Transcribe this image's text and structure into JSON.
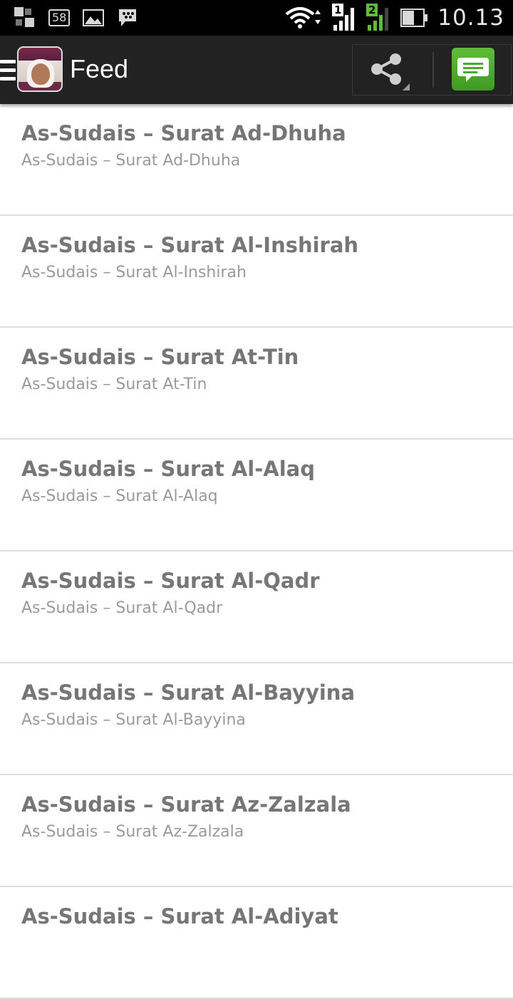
{
  "status_bar": {
    "badge_text": "58",
    "sim1_label": "1",
    "sim2_label": "2",
    "clock": "10.13"
  },
  "action_bar": {
    "title": "Feed",
    "share_icon": "share-icon",
    "chat_icon": "chat-icon",
    "chat_color": "#4aa82a"
  },
  "feed": {
    "items": [
      {
        "title": "As-Sudais – Surat Ad-Dhuha",
        "subtitle": "As-Sudais – Surat Ad-Dhuha"
      },
      {
        "title": "As-Sudais – Surat Al-Inshirah",
        "subtitle": "As-Sudais – Surat Al-Inshirah"
      },
      {
        "title": "As-Sudais – Surat At-Tin",
        "subtitle": "As-Sudais – Surat At-Tin"
      },
      {
        "title": "As-Sudais – Surat Al-Alaq",
        "subtitle": "As-Sudais – Surat Al-Alaq"
      },
      {
        "title": "As-Sudais – Surat Al-Qadr",
        "subtitle": "As-Sudais – Surat Al-Qadr"
      },
      {
        "title": "As-Sudais – Surat Al-Bayyina",
        "subtitle": "As-Sudais – Surat Al-Bayyina"
      },
      {
        "title": "As-Sudais – Surat Az-Zalzala",
        "subtitle": "As-Sudais – Surat Az-Zalzala"
      },
      {
        "title": "As-Sudais – Surat Al-Adiyat",
        "subtitle": ""
      }
    ]
  }
}
